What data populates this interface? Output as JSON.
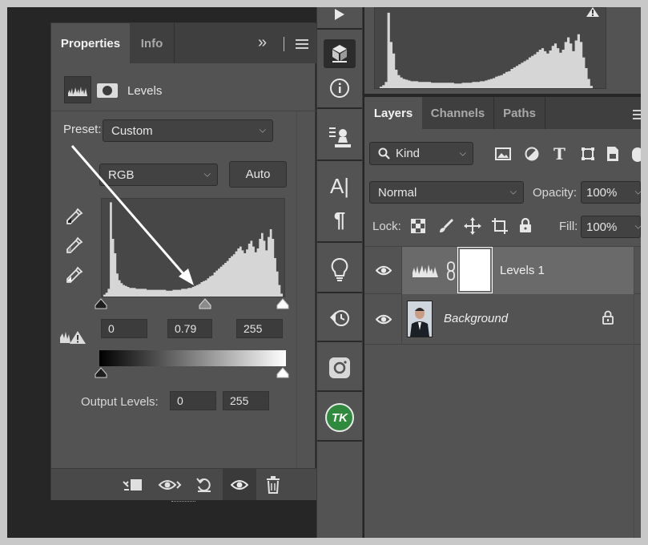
{
  "properties": {
    "tabs": [
      {
        "label": "Properties"
      },
      {
        "label": "Info"
      }
    ],
    "collapse_glyph": "»",
    "menu_icon": "hamburger-icon",
    "title": "Levels",
    "preset_label": "Preset:",
    "preset_value": "Custom",
    "channel_value": "RGB",
    "auto_label": "Auto",
    "input_levels": {
      "shadows": "0",
      "midtones": "0.79",
      "highlights": "255"
    },
    "output_label": "Output Levels:",
    "output_levels": {
      "low": "0",
      "high": "255"
    },
    "footer_icons": [
      "clip-to-layer-icon",
      "view-previous-state-icon",
      "reset-icon",
      "visibility-eye-icon",
      "delete-icon"
    ]
  },
  "toolbar_icons": [
    "play-icon",
    "3d-cube-icon",
    "info-icon",
    "paragraph-styles-icon",
    "character-icon",
    "paragraph-icon",
    "light-bulb-icon",
    "history-icon",
    "instagram-icon",
    "tk-logo-icon"
  ],
  "layers_panel": {
    "tabs": [
      {
        "label": "Layers"
      },
      {
        "label": "Channels"
      },
      {
        "label": "Paths"
      }
    ],
    "filter_value": "Kind",
    "blend_mode": "Normal",
    "opacity_label": "Opacity:",
    "opacity_value": "100%",
    "lock_label": "Lock:",
    "fill_label": "Fill:",
    "fill_value": "100%",
    "layers": [
      {
        "name": "Levels 1",
        "selected": true
      },
      {
        "name": "Background",
        "italic": true,
        "locked": true
      }
    ]
  },
  "histogram_data": {
    "bins": [
      2,
      4,
      8,
      98,
      60,
      45,
      24,
      17,
      14,
      12,
      11,
      10,
      9,
      9,
      9,
      8,
      8,
      8,
      8,
      8,
      7,
      7,
      7,
      7,
      7,
      7,
      7,
      7,
      7,
      6,
      6,
      6,
      7,
      7,
      7,
      7,
      8,
      8,
      8,
      9,
      9,
      10,
      11,
      12,
      13,
      15,
      16,
      17,
      19,
      21,
      22,
      25,
      27,
      29,
      31,
      33,
      35,
      37,
      40,
      42,
      44,
      47,
      50,
      52,
      48,
      45,
      49,
      55,
      58,
      52,
      46,
      50,
      60,
      66,
      58,
      48,
      62,
      70,
      60,
      40,
      26,
      12,
      3
    ]
  },
  "colors": {
    "accent_arrow": "#ffffff",
    "panel": "#535353",
    "dark": "#262626"
  }
}
